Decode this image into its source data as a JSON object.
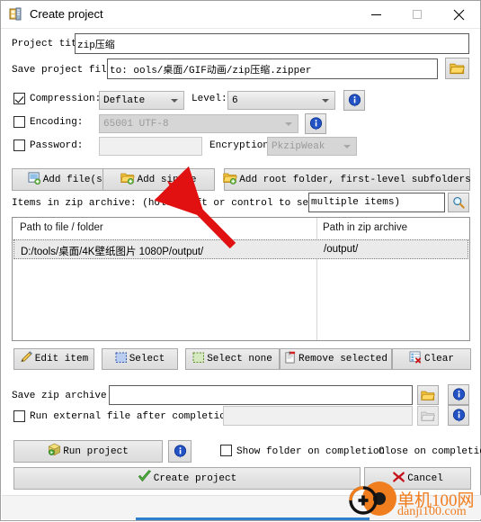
{
  "window": {
    "title": "Create project",
    "icon": "app-window-icon",
    "minimize": "minimize-icon",
    "maximize": "maximize-icon",
    "close": "close-icon"
  },
  "project": {
    "title_label": "Project title:",
    "title_value": "zip压缩",
    "save_label": "Save project file to:",
    "save_value": "to: ools/桌面/GIF动画/zip压缩.zipper",
    "browse_icon": "folder-open-icon"
  },
  "options": {
    "compression_label": "Compression:",
    "compression_checked": true,
    "compression_value": "Deflate",
    "level_label": "Level:",
    "level_value": "6",
    "encoding_label": "Encoding:",
    "encoding_checked": false,
    "encoding_value": "65001 UTF-8",
    "password_label": "Password:",
    "password_checked": false,
    "password_value": "",
    "encryption_label": "Encryption:",
    "encryption_value": "PkzipWeak",
    "info_icon": "info-icon"
  },
  "add_buttons": [
    {
      "label": "Add file(s)",
      "icon": "add-file-icon"
    },
    {
      "label": "Add single",
      "icon": "add-folder-icon"
    },
    {
      "label": "Add root folder, first-level subfolders",
      "icon": "add-root-folder-icon"
    }
  ],
  "items": {
    "label": "Items in zip archive: (hold shift or control to select multiple items)",
    "filter_value": "multiple items)",
    "search_icon": "search-icon",
    "columns": [
      "Path to file / folder",
      "Path in zip archive"
    ],
    "rows": [
      {
        "path": "D:/tools/桌面/4K壁纸图片 1080P/output/",
        "zip_path": "/output/",
        "selected": true
      }
    ]
  },
  "item_buttons": [
    {
      "label": "Edit item",
      "icon": "pencil-icon"
    },
    {
      "label": "Select",
      "icon": "select-all-icon"
    },
    {
      "label": "Select none",
      "icon": "select-none-icon"
    },
    {
      "label": "Remove selected",
      "icon": "remove-icon"
    },
    {
      "label": "Clear",
      "icon": "clear-icon"
    }
  ],
  "output": {
    "save_zip_label": "Save zip archive to:",
    "save_zip_value": "",
    "save_zip_browse_icon": "folder-open-icon",
    "save_zip_info_icon": "info-icon",
    "run_external_label": "Run external file after completion:",
    "run_external_checked": false,
    "run_external_value": "",
    "run_external_browse_icon": "folder-open-disabled-icon",
    "run_external_info_icon": "info-icon"
  },
  "actions": {
    "run_project_label": "Run project",
    "run_project_icon": "package-run-icon",
    "run_info_icon": "info-icon",
    "show_folder_label": "Show folder on completion",
    "show_folder_checked": false,
    "close_on_completion_label": "Close on completion",
    "create_label": "Create project",
    "create_icon": "check-icon",
    "cancel_label": "Cancel",
    "cancel_icon": "x-icon"
  },
  "watermark": {
    "line1": "单机100网",
    "line2": "danji100.com",
    "color": "#f07d1e"
  },
  "colors": {
    "accent": "#2f7fd0",
    "info_blue": "#1b53c0",
    "folder_yellow": "#f5c344",
    "green_check": "#4aae3a",
    "red_x": "#c4111a",
    "annotation_arrow": "#e11111"
  }
}
